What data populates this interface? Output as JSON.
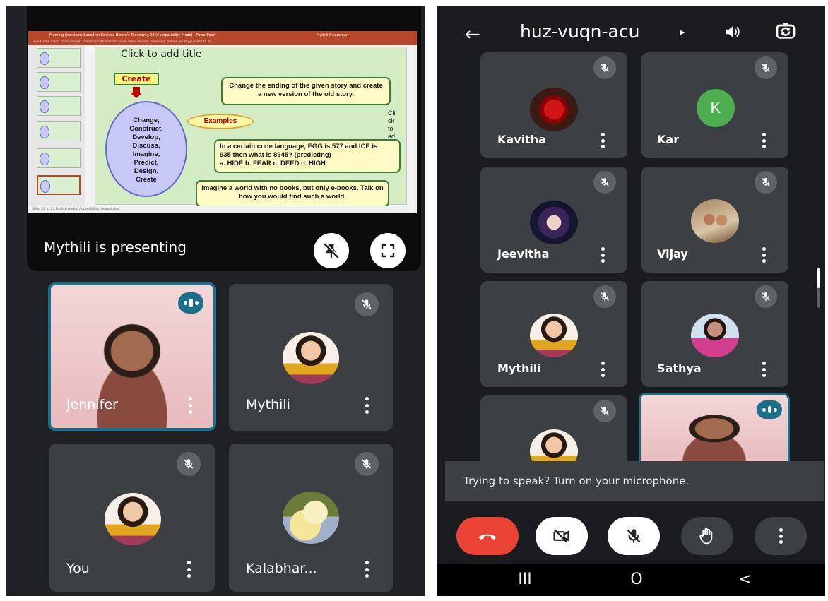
{
  "presentation": {
    "slide": {
      "ppt_title_bar": "Framing Questions based on Revised Bloom's Taxonomy 20 (Compatibility Mode) - PowerPoint",
      "ppt_user": "Mythili Sivaraman",
      "ribbon_tabs": "File   Home   Insert   Draw   Design   Transitions   Animations   Slide Show   Review   View   Help   Tell me what you want to do",
      "status_text": "Slide 22 of 23    English (India)    Accessibility: Unavailable",
      "title_placeholder": "Click to add title",
      "create_label": "Create",
      "verbs": [
        "Change,",
        "Construct,",
        "Develop,",
        "Discuss,",
        "Imagine,",
        "Predict,",
        "Design,",
        "Create"
      ],
      "examples_label": "Examples",
      "box1_text": "Change the ending of the given story and create a new version of the old story.",
      "box2_line1": "In a certain code language, EGG is 577 and ICE is",
      "box2_line2": "935 then what is 8945? (predicting)",
      "box2_line3": "a. HIDE b. FEAR c. DEED d. HIGH",
      "box3_text": "Imagine a world with no books, but only e-books. Talk on how you would find such a world.",
      "side_placeholder": "Cli ck to ad"
    },
    "presenting_label": "Mythili is presenting",
    "pin_icon": "unpin-icon",
    "fullscreen_icon": "fullscreen-icon"
  },
  "left_tiles": [
    {
      "name": "Jennifer",
      "state": "speaking"
    },
    {
      "name": "Mythili",
      "state": "muted"
    },
    {
      "name": "You",
      "state": "muted"
    },
    {
      "name": "Kalabhar...",
      "state": "muted"
    }
  ],
  "header": {
    "back_icon": "back-arrow-icon",
    "meeting_code": "huz-vuqn-acu",
    "caret": "▸",
    "speaker_icon": "speaker-icon",
    "camera_switch_icon": "switch-camera-icon"
  },
  "right_tiles": [
    {
      "name": "Kavitha",
      "state": "muted"
    },
    {
      "name": "Kar",
      "state": "muted",
      "initial": "K"
    },
    {
      "name": "Jeevitha",
      "state": "muted"
    },
    {
      "name": "Vijay",
      "state": "muted"
    },
    {
      "name": "Mythili",
      "state": "muted"
    },
    {
      "name": "Sathya",
      "state": "muted"
    },
    {
      "name": "",
      "state": "muted"
    },
    {
      "name": "",
      "state": "speaking"
    }
  ],
  "toast": {
    "text": "Trying to speak? Turn on your microphone."
  },
  "controls": {
    "end_call_icon": "end-call-icon",
    "camera_icon": "camera-off-icon",
    "mic_icon": "mic-off-icon",
    "hand_icon": "raise-hand-icon",
    "more_icon": "more-options-icon",
    "end_call_color": "#ea4335"
  },
  "navbar": {
    "recents": "III",
    "home": "O",
    "back": "<"
  }
}
